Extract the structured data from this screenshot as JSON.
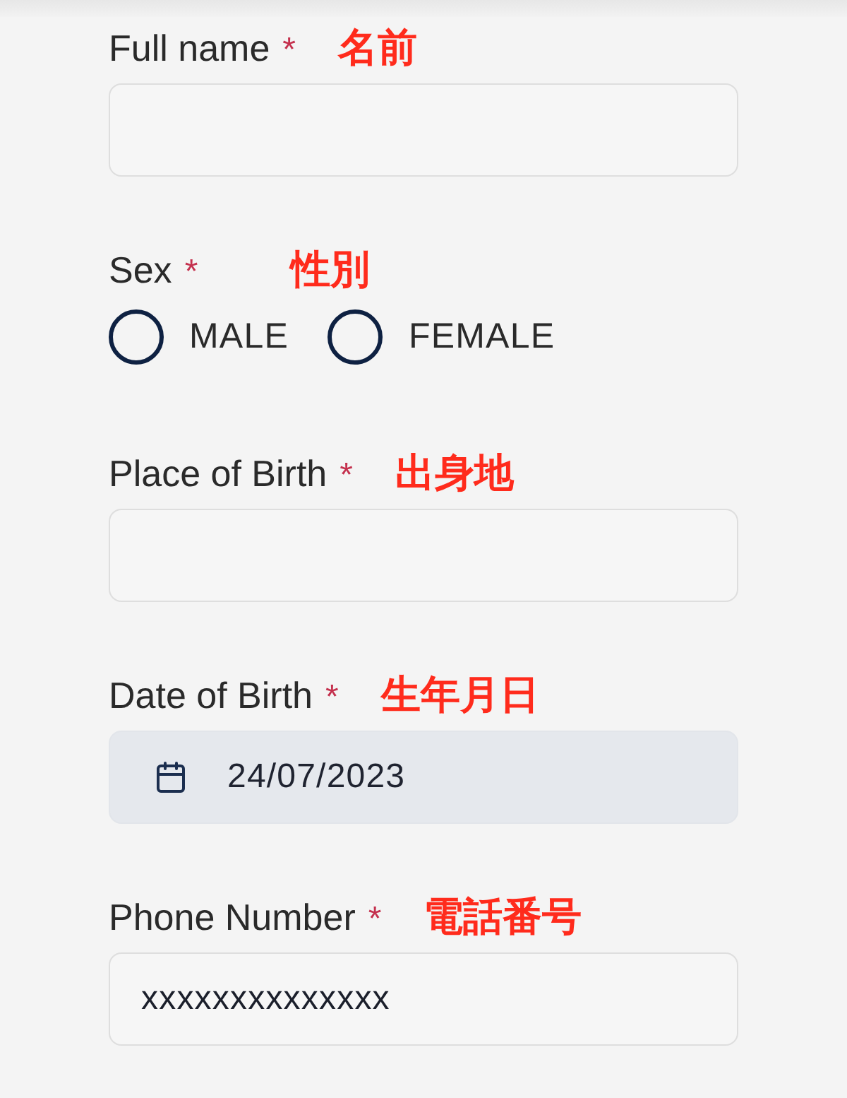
{
  "fields": [
    {
      "kind": "text",
      "label": "Full name",
      "required_mark": "*",
      "annotation": "名前",
      "disabled": false
    },
    {
      "kind": "radio",
      "label": "Sex",
      "required_mark": "*",
      "annotation": "性別",
      "options": [
        {
          "label": "MALE",
          "selected": false
        },
        {
          "label": "FEMALE",
          "selected": false
        }
      ]
    },
    {
      "kind": "text",
      "label": "Place of Birth",
      "required_mark": "*",
      "annotation": "出身地",
      "disabled": false
    },
    {
      "kind": "date",
      "label": "Date of Birth",
      "required_mark": "*",
      "annotation": "生年月日",
      "value": "24/07/2023",
      "disabled": true
    },
    {
      "kind": "text",
      "label": "Phone Number",
      "required_mark": "*",
      "annotation": "電話番号",
      "value": "xxxxxxxxxxxxxx",
      "disabled": false
    }
  ]
}
